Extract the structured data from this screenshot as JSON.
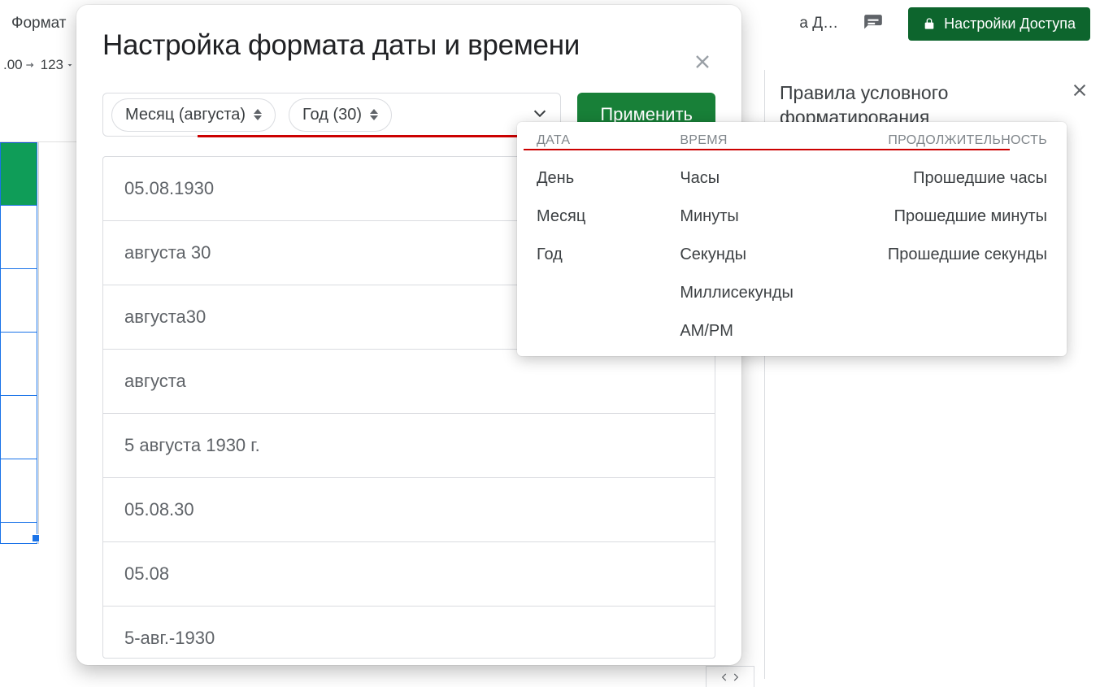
{
  "bg": {
    "menu_format": "Формат",
    "truncated_title_tail": "а Д…",
    "share_button": "Настройки Доступа",
    "tool_00": ".00",
    "tool_123": "123"
  },
  "side_panel": {
    "title_line1": "Правила условного",
    "title_line2": "форматирования"
  },
  "modal": {
    "title": "Настройка формата даты и времени",
    "chip_month": "Месяц (августа)",
    "chip_year": "Год (30)",
    "apply": "Применить",
    "formats": [
      "05.08.1930",
      "августа 30",
      "августа30",
      "августа",
      "5 августа 1930 г.",
      "05.08.30",
      "05.08",
      "5-авг.-1930"
    ]
  },
  "popover": {
    "headers": {
      "date": "ДАТА",
      "time": "ВРЕМЯ",
      "duration": "ПРОДОЛЖИТЕЛЬНОСТЬ"
    },
    "date_opts": [
      "День",
      "Месяц",
      "Год"
    ],
    "time_opts": [
      "Часы",
      "Минуты",
      "Секунды",
      "Миллисекунды",
      "AM/PM"
    ],
    "duration_opts": [
      "Прошедшие часы",
      "Прошедшие минуты",
      "Прошедшие секунды"
    ]
  }
}
